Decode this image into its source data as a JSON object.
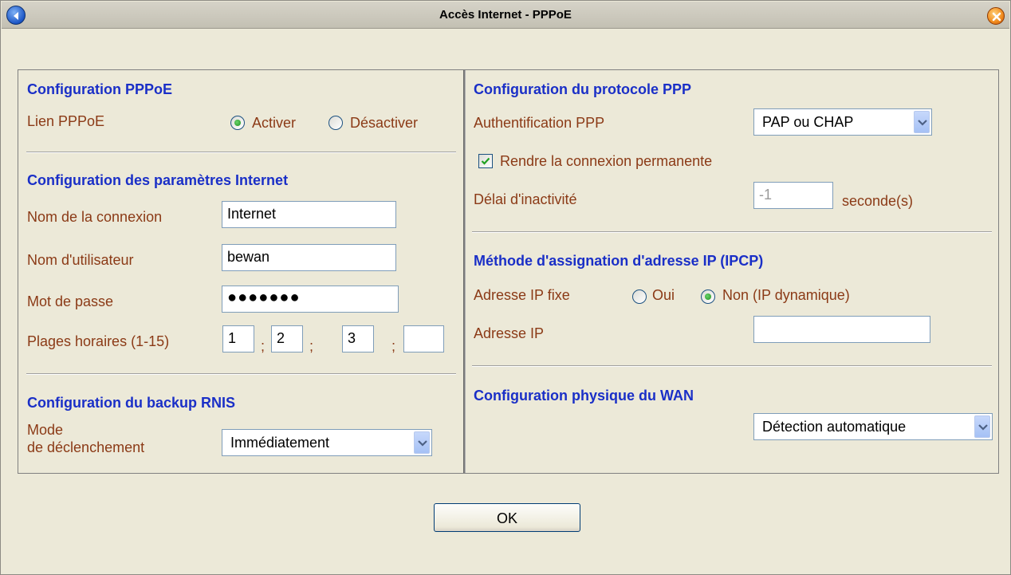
{
  "window": {
    "title": "Accès Internet - PPPoE",
    "back_icon": "back-arrow-icon",
    "close_icon": "close-x-icon"
  },
  "pppoe": {
    "heading": "Configuration PPPoE",
    "link_label": "Lien PPPoE",
    "options": [
      "Activer",
      "Désactiver"
    ],
    "selected": "Activer"
  },
  "internet": {
    "heading": "Configuration des paramètres Internet",
    "connection_name_label": "Nom de la connexion",
    "connection_name_value": "Internet",
    "username_label": "Nom d'utilisateur",
    "username_value": "bewan",
    "password_label": "Mot de passe",
    "password_value": "●●●●●●●",
    "schedule_label": "Plages horaires (1-15)",
    "schedule_values": [
      "1",
      "2",
      "3",
      ""
    ],
    "separator": ";"
  },
  "backup": {
    "heading": "Configuration du backup RNIS",
    "mode_label_line1": "Mode",
    "mode_label_line2": "de déclenchement",
    "mode_value": "Immédiatement"
  },
  "ppp": {
    "heading": "Configuration du protocole PPP",
    "auth_label": "Authentification PPP",
    "auth_value": "PAP ou CHAP",
    "permanent_label": "Rendre la connexion permanente",
    "permanent_checked": true,
    "idle_label": "Délai d'inactivité",
    "idle_value": "-1",
    "idle_unit": "seconde(s)"
  },
  "ipcp": {
    "heading": "Méthode d'assignation d'adresse IP (IPCP)",
    "fixed_label": "Adresse IP fixe",
    "options": [
      "Oui",
      "Non (IP dynamique)"
    ],
    "selected": "Non (IP dynamique)",
    "ip_label": "Adresse IP",
    "ip_value": ""
  },
  "wan": {
    "heading": "Configuration physique du WAN",
    "mode_value": "Détection automatique"
  },
  "footer": {
    "ok_label": "OK"
  }
}
